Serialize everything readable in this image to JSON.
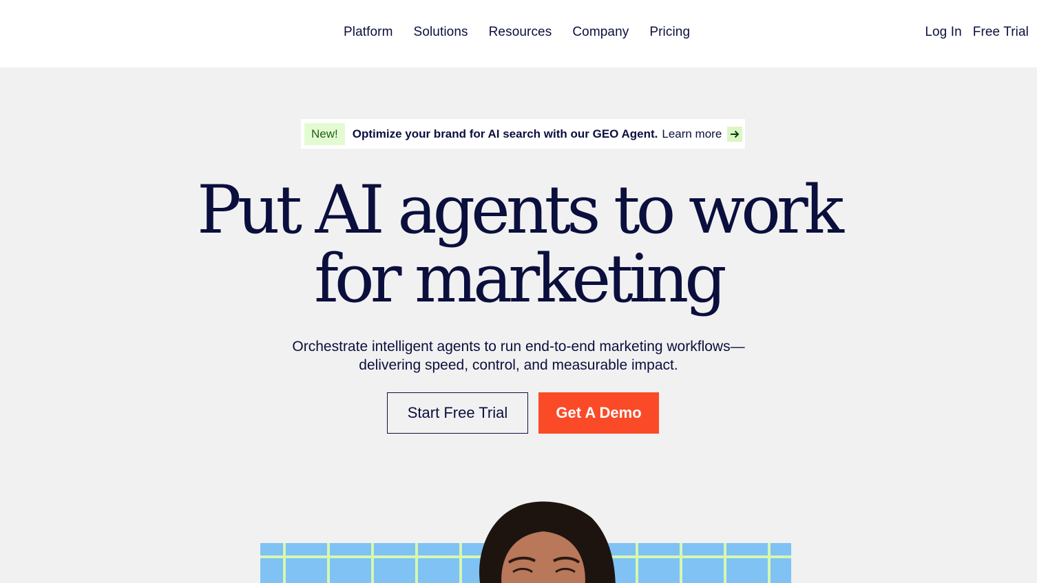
{
  "header": {
    "nav": [
      "Platform",
      "Solutions",
      "Resources",
      "Company",
      "Pricing"
    ],
    "login": "Log In",
    "free_trial": "Free Trial"
  },
  "announcement": {
    "badge": "New!",
    "text": "Optimize your brand for AI search with our GEO Agent.",
    "link": "Learn more",
    "icon": "arrow-right-icon"
  },
  "hero": {
    "title_line1": "Put AI agents to work",
    "title_line2": "for marketing",
    "subtitle_line1": "Orchestrate intelligent agents to run end-to-end marketing workflows—",
    "subtitle_line2": "delivering speed, control, and measurable impact.",
    "cta_primary": "Start Free Trial",
    "cta_secondary": "Get A Demo"
  },
  "colors": {
    "navy": "#0b0f3d",
    "accent": "#fb4a27",
    "badge_bg": "#e3fbd2",
    "grid_blue": "#7fc2f3",
    "grid_line": "#d6f7b0"
  }
}
